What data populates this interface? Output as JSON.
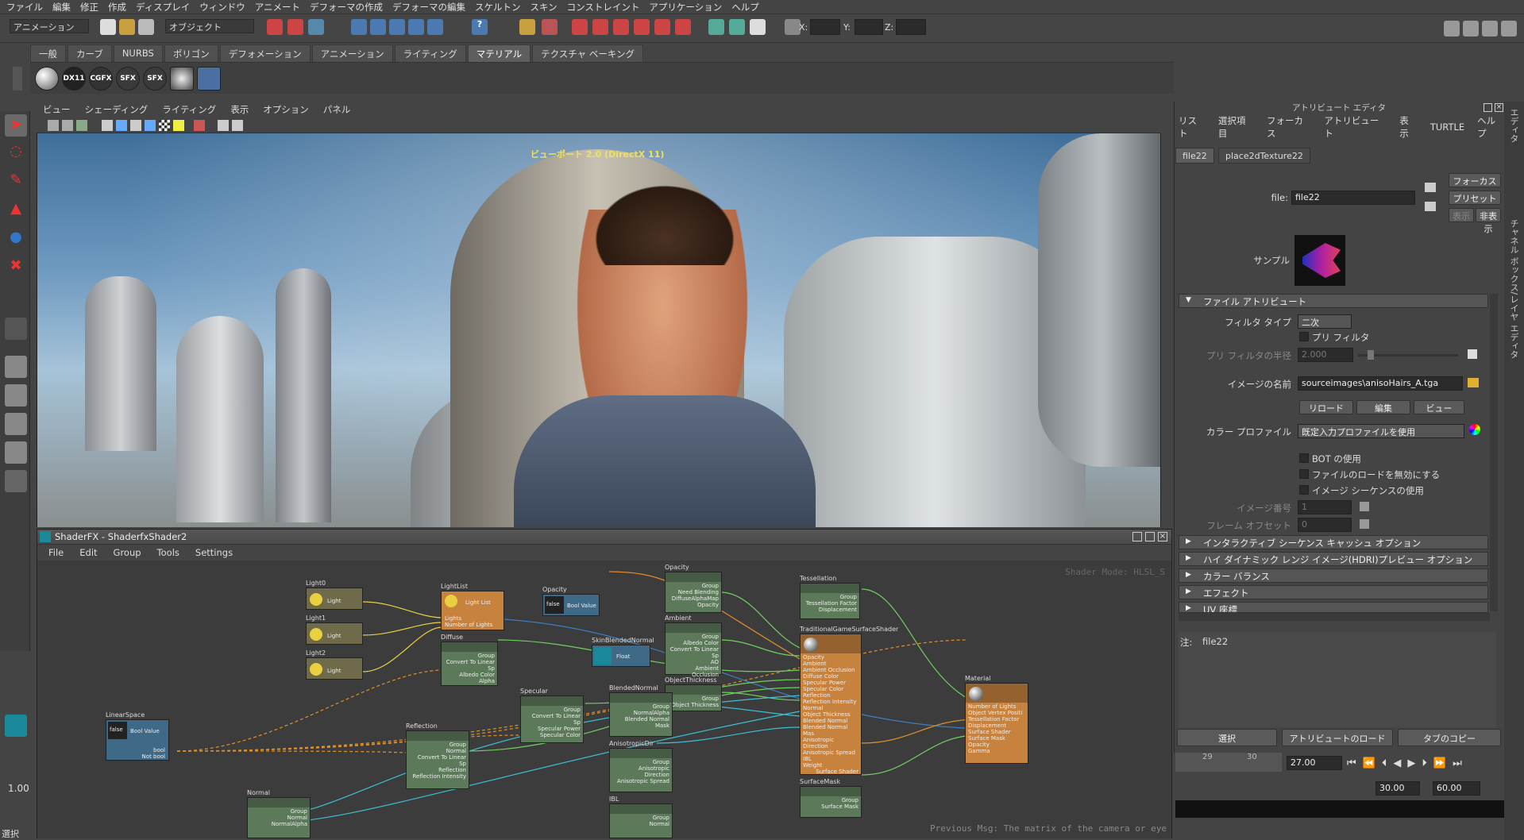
{
  "menubar": {
    "items": [
      "ファイル",
      "編集",
      "修正",
      "作成",
      "ディスプレイ",
      "ウィンドウ",
      "アニメート",
      "デフォーマの作成",
      "デフォーマの編集",
      "スケルトン",
      "スキン",
      "コンストレイント",
      "アプリケーション",
      "ヘルプ"
    ]
  },
  "status": {
    "mode": "アニメーション",
    "select_mode": "オブジェクト",
    "x_label": "X:",
    "y_label": "Y:",
    "z_label": "Z:"
  },
  "shelf": {
    "tabs": [
      "一般",
      "カーブ",
      "NURBS",
      "ポリゴン",
      "デフォメーション",
      "アニメーション",
      "ライティング",
      "マテリアル",
      "テクスチャ ベーキング"
    ],
    "active": "マテリアル",
    "icons": [
      "DX11",
      "CGFX",
      "SFX",
      "SFX"
    ]
  },
  "viewport": {
    "menu": [
      "ビュー",
      "シェーディング",
      "ライティング",
      "表示",
      "オプション",
      "パネル"
    ],
    "title": "ビューポート 2.0 (DirectX 11)"
  },
  "shaderfx": {
    "title": "ShaderFX - ShaderfxShader2",
    "menu": [
      "File",
      "Edit",
      "Group",
      "Tools",
      "Settings"
    ],
    "shader_mode": "Shader Mode: HLSL_S",
    "previous_msg": "Previous Msg: The matrix of the camera or eye",
    "nodes": [
      {
        "title": "Light0",
        "body": "Light"
      },
      {
        "title": "Light1",
        "body": "Light"
      },
      {
        "title": "Light2",
        "body": "Light"
      },
      {
        "title": "LightList",
        "body": "Light List",
        "rows": [
          "Lights",
          "Number of Lights"
        ]
      },
      {
        "title": "Opacity",
        "body": "Bool Value",
        "value": "false"
      },
      {
        "title": "Diffuse",
        "body": "Group",
        "rows": [
          "Convert To Linear Sp",
          "Albedo Color",
          "Alpha"
        ]
      },
      {
        "title": "SkinBlendedNormal",
        "body": "Float"
      },
      {
        "title": "Opacity",
        "body": "Group",
        "rows": [
          "Need Blending",
          "DiffuseAlphaMap",
          "Opacity"
        ]
      },
      {
        "title": "Ambient",
        "body": "Group",
        "rows": [
          "Albedo Color",
          "Convert To Linear Sp",
          "AO",
          "Ambient Occlusion"
        ]
      },
      {
        "title": "ObjectThickness",
        "body": "Group",
        "rows": [
          "Object Thickness"
        ]
      },
      {
        "title": "Tessellation",
        "body": "Group",
        "rows": [
          "Tessellation Factor",
          "Displacement"
        ]
      },
      {
        "title": "TraditionalGameSurfaceShader",
        "rows": [
          "Opacity",
          "Ambient",
          "Ambient Occlusion",
          "Diffuse Color",
          "Specular Power",
          "Specular Color",
          "Reflection",
          "Reflection Intensity",
          "Normal",
          "Object Thickness",
          "Blended Normal",
          "Blended Normal Mas",
          "Anisotropic Direction",
          "Anisotropic Spread",
          "IBL",
          "Weight",
          "Surface Shader"
        ]
      },
      {
        "title": "Material",
        "rows": [
          "Number of Lights",
          "Object Vertex Positi",
          "Tessellation Factor",
          "Displacement",
          "Surface Shader",
          "Surface Mask",
          "Opacity",
          "Gamma"
        ]
      },
      {
        "title": "LinearSpace",
        "body": "Bool Value",
        "value": "false",
        "rows": [
          "bool",
          "Not bool"
        ]
      },
      {
        "title": "Reflection",
        "body": "Group",
        "rows": [
          "Normal",
          "Convert To Linear Sp",
          "Reflection",
          "Reflection Intensity"
        ]
      },
      {
        "title": "Specular",
        "body": "Group",
        "rows": [
          "Convert To Linear Sp",
          "Specular Power",
          "Specular Color"
        ]
      },
      {
        "title": "BlendedNormal",
        "body": "Group",
        "rows": [
          "NormalAlpha",
          "Blended Normal Mask"
        ]
      },
      {
        "title": "AnisotropicDir",
        "body": "Group",
        "rows": [
          "Anisotropic Direction",
          "Anisotropic Spread"
        ]
      },
      {
        "title": "SurfaceMask",
        "body": "Group",
        "rows": [
          "Surface Mask"
        ]
      },
      {
        "title": "Normal",
        "body": "Group",
        "rows": [
          "Normal",
          "NormalAlpha"
        ]
      },
      {
        "title": "IBL",
        "body": "Group",
        "rows": [
          "Normal"
        ]
      }
    ]
  },
  "attr": {
    "title": "アトリビュート エディタ",
    "menu": [
      "リスト",
      "選択項目",
      "フォーカス",
      "アトリビュート",
      "表示",
      "TURTLE",
      "ヘルプ"
    ],
    "tabs": [
      "file22",
      "place2dTexture22"
    ],
    "focus_btn": "フォーカス",
    "preset_btn": "プリセット",
    "show_btn": "表示",
    "hide_btn": "非表示",
    "file_label": "file:",
    "file_value": "file22",
    "sample_label": "サンプル",
    "section_file": "ファイル アトリビュート",
    "filter_type_label": "フィルタ タイプ",
    "filter_type_value": "二次",
    "prefilter_label": "プリ フィルタ",
    "prefilter_radius_label": "プリ フィルタの半径",
    "prefilter_radius_value": "2.000",
    "image_name_label": "イメージの名前",
    "image_name_value": "sourceimages\\anisoHairs_A.tga",
    "reload_btn": "リロード",
    "edit_btn": "編集",
    "view_btn": "ビュー",
    "color_profile_label": "カラー プロファイル",
    "color_profile_value": "既定入力プロファイルを使用",
    "bot_label": "BOT の使用",
    "disable_load_label": "ファイルのロードを無効にする",
    "use_seq_label": "イメージ シーケンスの使用",
    "image_number_label": "イメージ番号",
    "image_number_value": "1",
    "frame_offset_label": "フレーム オフセット",
    "frame_offset_value": "0",
    "sections": [
      "インタラクティブ シーケンス キャッシュ オプション",
      "ハイ ダイナミック レンジ イメージ(HDRI)プレビュー オプション",
      "カラー バランス",
      "エフェクト",
      "UV 座標"
    ],
    "notes_label": "注:",
    "notes_value": "file22",
    "select_btn": "選択",
    "load_attr_btn": "アトリビュートのロード",
    "copy_tab_btn": "タブのコピー"
  },
  "time": {
    "ticks": [
      "29",
      "30"
    ],
    "current": "27.00",
    "range_start": "1.00",
    "range_inner": "30.00",
    "range_end": "60.00",
    "cmd_lang": "選択"
  },
  "side_tabs": {
    "attr_editor": "アトリビュート エディタ",
    "channel_box": "チャネル ボックス/レイヤ エディタ"
  },
  "toolbox": {
    "value": "1.00"
  }
}
